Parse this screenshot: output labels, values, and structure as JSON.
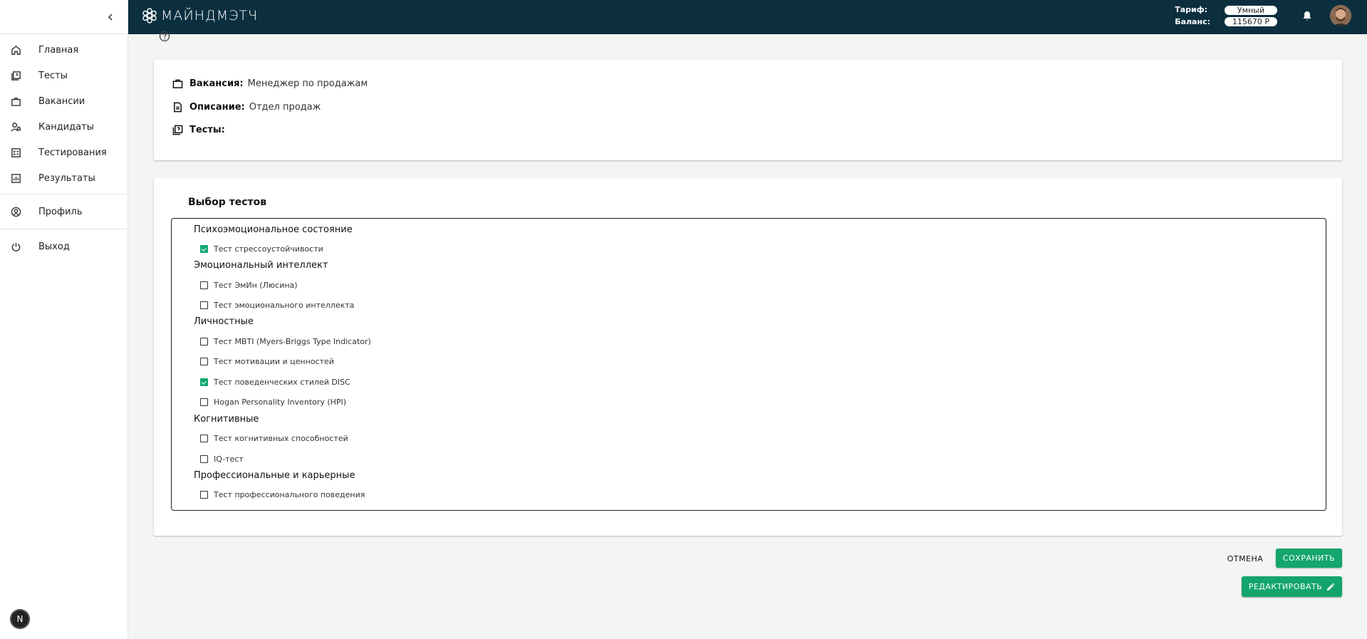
{
  "brand": {
    "name": "МАЙНДМЭТЧ",
    "accent": "#13a56c",
    "header_bg": "#0b2f3f"
  },
  "header": {
    "tariff_label": "Тариф:",
    "tariff_value": "Умный",
    "balance_label": "Баланс:",
    "balance_value": "115670 Р",
    "icons": [
      "bell-icon",
      "avatar"
    ]
  },
  "sidebar": {
    "collapse_icon": "chevron-left-icon",
    "items": [
      {
        "label": "Главная",
        "icon": "home-icon"
      },
      {
        "label": "Тесты",
        "icon": "tests-icon"
      },
      {
        "label": "Вакансии",
        "icon": "briefcase-icon"
      },
      {
        "label": "Кандидаты",
        "icon": "candidates-icon"
      },
      {
        "label": "Тестирования",
        "icon": "checklist-icon"
      },
      {
        "label": "Результаты",
        "icon": "chart-icon"
      },
      {
        "label": "Профиль",
        "icon": "user-circle-icon"
      },
      {
        "label": "Выход",
        "icon": "power-icon"
      }
    ],
    "badge": "N"
  },
  "vacancy": {
    "vacancy_label": "Вакансия:",
    "vacancy_value": "Менеджер по продажам",
    "description_label": "Описание:",
    "description_value": "Отдел продаж",
    "tests_label": "Тесты:"
  },
  "test_selection": {
    "title": "Выбор тестов",
    "categories": [
      {
        "name": "Психоэмоциональное состояние",
        "tests": [
          {
            "label": "Тест стрессоустойчивости",
            "checked": true
          }
        ]
      },
      {
        "name": "Эмоциональный интеллект",
        "tests": [
          {
            "label": "Тест ЭмИн (Люсина)",
            "checked": false
          },
          {
            "label": "Тест эмоционального интеллекта",
            "checked": false
          }
        ]
      },
      {
        "name": "Личностные",
        "tests": [
          {
            "label": "Тест MBTI (Myers-Briggs Type Indicator)",
            "checked": false
          },
          {
            "label": "Тест мотивации и ценностей",
            "checked": false
          },
          {
            "label": "Тест поведенческих стилей DISC",
            "checked": true
          },
          {
            "label": "Hogan Personality Inventory (HPI)",
            "checked": false
          }
        ]
      },
      {
        "name": "Когнитивные",
        "tests": [
          {
            "label": "Тест когнитивных способностей",
            "checked": false
          },
          {
            "label": "IQ-тест",
            "checked": false
          }
        ]
      },
      {
        "name": "Профессиональные и карьерные",
        "tests": [
          {
            "label": "Тест профессионального поведения",
            "checked": false
          }
        ]
      }
    ]
  },
  "actions": {
    "cancel": "ОТМЕНА",
    "save": "СОХРАНИТЬ",
    "edit": "РЕДАКТИРОВАТЬ"
  }
}
